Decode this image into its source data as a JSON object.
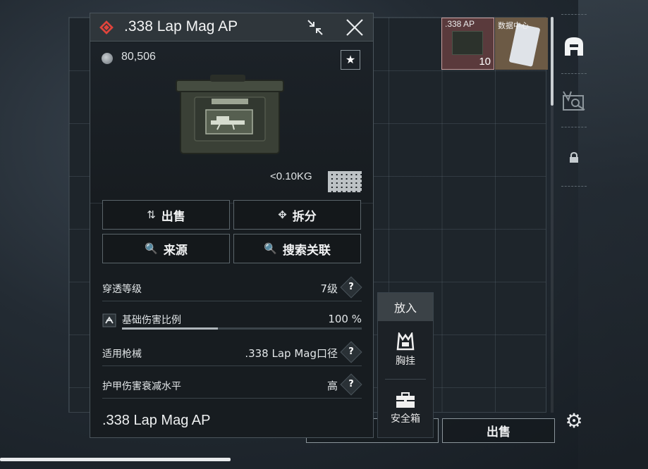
{
  "inventory": {
    "slots": [
      {
        "label": ".338 AP",
        "count": "10"
      },
      {
        "label": "数据中心"
      }
    ]
  },
  "bottom_bar": {
    "sell_label": "出售"
  },
  "putin_menu": {
    "title": "放入",
    "items": [
      {
        "label": "胸挂",
        "icon": "chest-rig-icon"
      },
      {
        "label": "安全箱",
        "icon": "safe-box-icon"
      }
    ]
  },
  "item": {
    "name": ".338 Lap Mag AP",
    "price": "80,506",
    "weight": "<0.10KG",
    "actions": {
      "sell": "出售",
      "split": "拆分",
      "source": "来源",
      "search_related": "搜索关联"
    },
    "properties": [
      {
        "label": "穿透等级",
        "value": "7级"
      },
      {
        "label": "基础伤害比例",
        "value": "100 %",
        "bar_fraction": 0.4
      },
      {
        "label": "适用枪械",
        "value": ".338 Lap Mag口径"
      },
      {
        "label": "护甲伤害衰减水平",
        "value": "高"
      }
    ],
    "footer_name": ".338 Lap Mag AP",
    "rarity_color": "#e0443c"
  },
  "help_symbol": "?",
  "favorite_symbol": "★"
}
